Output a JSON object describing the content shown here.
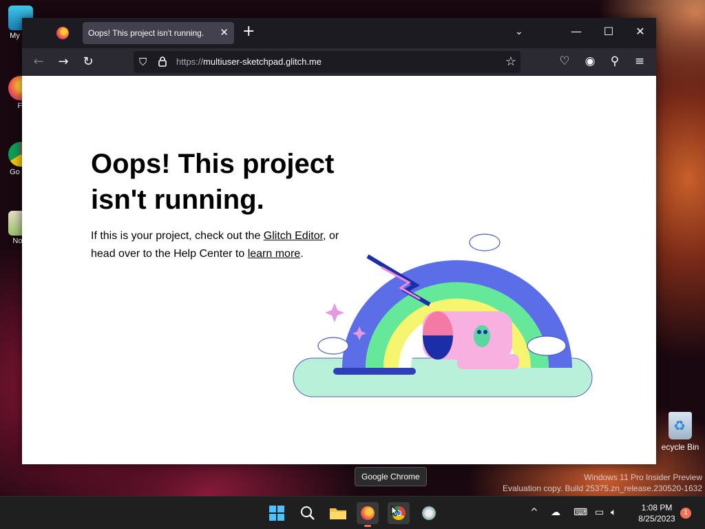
{
  "desktop": {
    "icons": [
      {
        "label": "My Co"
      },
      {
        "label": "Fi"
      },
      {
        "label": "Go Ch"
      },
      {
        "label": "Note"
      }
    ],
    "recycle_label": "ecycle Bin"
  },
  "browser": {
    "tab_title": "Oops! This project isn't running.",
    "url_protocol": "https://",
    "url_host": "multiuser-sketchpad.glitch.me"
  },
  "page": {
    "heading": "Oops! This project isn't running.",
    "text_part1": "If this is your project, check out the ",
    "link_editor": "Glitch Editor",
    "text_part2": ", or head over to the Help Center to ",
    "link_learn": "learn more",
    "text_part3": "."
  },
  "tooltip": "Google Chrome",
  "watermark": {
    "line1": "Windows 11 Pro Insider Preview",
    "line2": "Evaluation copy. Build 25375.zn_release.230520-1632"
  },
  "clock": {
    "time": "1:08 PM",
    "date": "8/25/2023"
  },
  "notification_count": "1",
  "colors": {
    "firefox_tab_bg": "#42414d",
    "toolbar_bg": "#2b2a33",
    "taskbar_bg": "#1f1f1f"
  }
}
